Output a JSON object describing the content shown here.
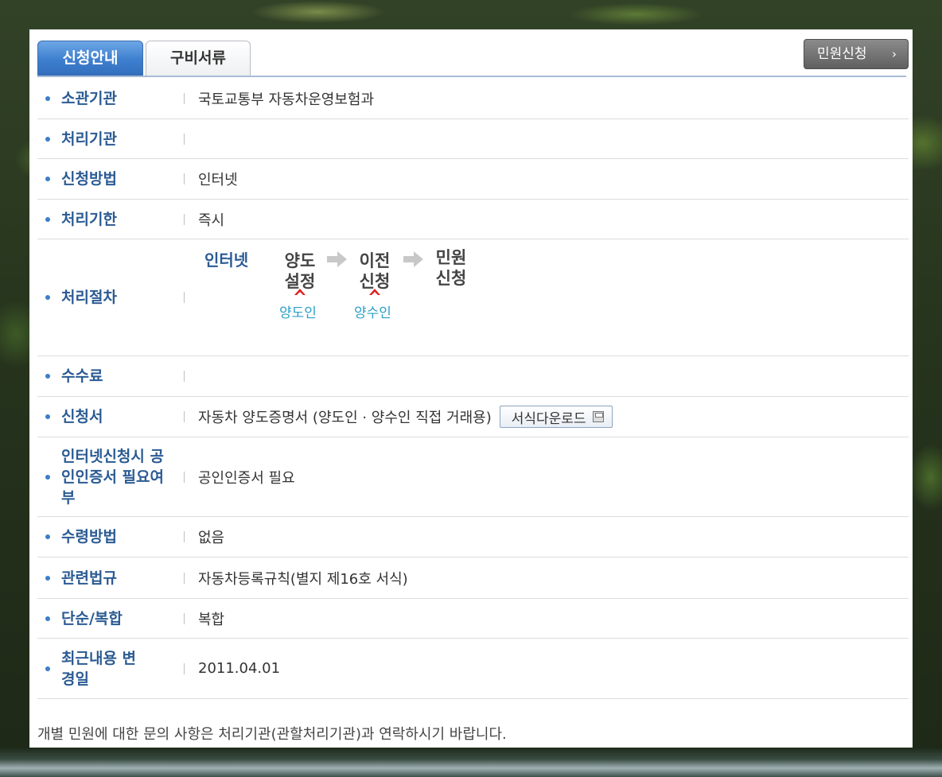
{
  "tabs": [
    {
      "label": "신청안내",
      "active": true
    },
    {
      "label": "구비서류",
      "active": false
    }
  ],
  "apply_button": {
    "label": "민원신청",
    "icon": "chevron-right-icon"
  },
  "rows": [
    {
      "label": "소관기관",
      "value": "국토교통부 자동차운영보험과"
    },
    {
      "label": "처리기관",
      "value": ""
    },
    {
      "label": "신청방법",
      "value": "인터넷"
    },
    {
      "label": "처리기한",
      "value": "즉시"
    },
    {
      "label": "처리절차",
      "value": ""
    },
    {
      "label": "수수료",
      "value": ""
    },
    {
      "label": "신청서",
      "value": "자동차 양도증명서 (양도인 · 양수인 직접 거래용)"
    },
    {
      "label": "인터넷신청시 공인인증서 필요여부",
      "value": "공인인증서 필요"
    },
    {
      "label": "수령방법",
      "value": "없음"
    },
    {
      "label": "관련법규",
      "value": "자동차등록규칙(별지 제16호 서식)"
    },
    {
      "label": "단순/복합",
      "value": "복합"
    },
    {
      "label": "최근내용 변경일",
      "value": "2011.04.01"
    }
  ],
  "procedure": {
    "title": "인터넷",
    "steps": [
      {
        "label": "양도 설정",
        "role": "양도인"
      },
      {
        "label": "이전 신청",
        "role": "양수인"
      },
      {
        "label": "민원 신청",
        "role": ""
      }
    ]
  },
  "download_button": {
    "label": "서식다운로드",
    "icon": "floppy-disk-icon"
  },
  "footnote": "개별 민원에 대한 문의 사항은 처리기관(관할처리기관)과 연락하시기 바랍니다.",
  "colors": {
    "accent": "#3e7fcf",
    "label": "#2b5b93",
    "role": "#2ba0c9",
    "caret": "#e02020"
  }
}
